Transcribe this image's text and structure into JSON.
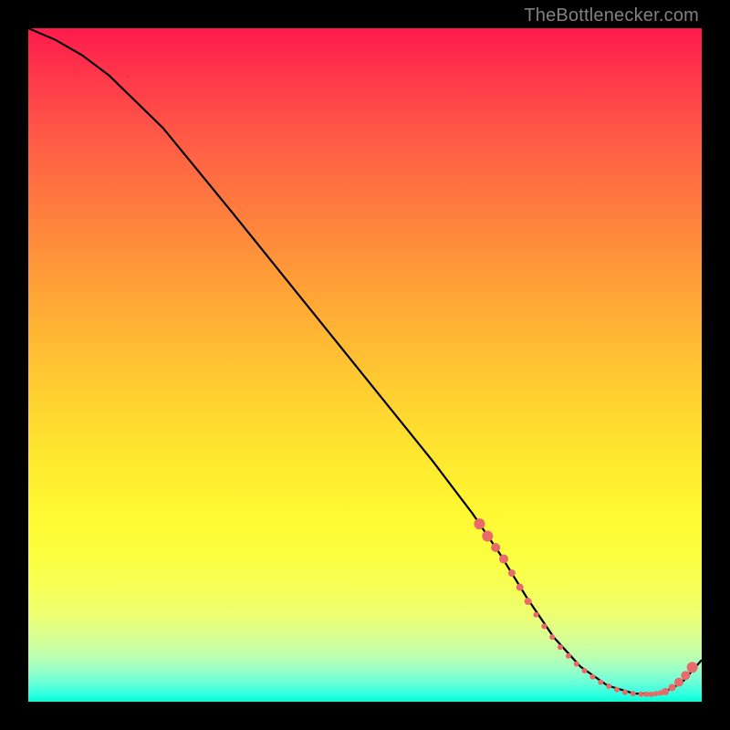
{
  "attribution": "TheBottlenecker.com",
  "chart_data": {
    "type": "line",
    "title": "",
    "xlabel": "",
    "ylabel": "",
    "xlim": [
      0,
      100
    ],
    "ylim": [
      0,
      100
    ],
    "series": [
      {
        "name": "curve",
        "color": "#000000",
        "x": [
          0,
          4,
          8,
          12,
          20,
          30,
          40,
          50,
          60,
          66,
          70,
          74,
          78,
          82,
          86,
          90,
          94,
          97,
          100
        ],
        "y": [
          100,
          98.3,
          96.0,
          93.0,
          85.2,
          73.0,
          60.6,
          48.2,
          35.8,
          27.9,
          22.0,
          15.5,
          9.6,
          5.2,
          2.4,
          1.2,
          1.2,
          2.8,
          6.2
        ]
      }
    ],
    "markers": {
      "name": "dotted-segment",
      "color": "#e86a6a",
      "radius_seq": [
        6,
        6,
        5,
        5,
        4,
        4,
        4,
        3,
        3,
        3,
        3,
        3,
        3,
        3,
        3,
        3,
        3,
        3,
        3,
        3,
        3,
        3,
        3,
        3,
        3,
        4,
        4,
        5,
        5,
        6
      ],
      "x": [
        67.0,
        68.2,
        69.4,
        70.6,
        71.8,
        73.0,
        74.2,
        75.4,
        76.6,
        77.8,
        79.0,
        80.2,
        81.4,
        82.6,
        83.8,
        85.0,
        86.2,
        87.4,
        88.6,
        89.8,
        91.0,
        91.8,
        92.5,
        93.2,
        93.9,
        94.6,
        95.6,
        96.6,
        97.6,
        98.6
      ],
      "y": [
        26.4,
        24.6,
        22.9,
        21.2,
        19.1,
        17.0,
        14.9,
        12.9,
        11.2,
        9.6,
        8.1,
        6.8,
        5.6,
        4.6,
        3.7,
        2.9,
        2.3,
        1.8,
        1.4,
        1.2,
        1.1,
        1.1,
        1.1,
        1.2,
        1.3,
        1.5,
        2.1,
        2.9,
        3.9,
        5.1
      ]
    }
  }
}
